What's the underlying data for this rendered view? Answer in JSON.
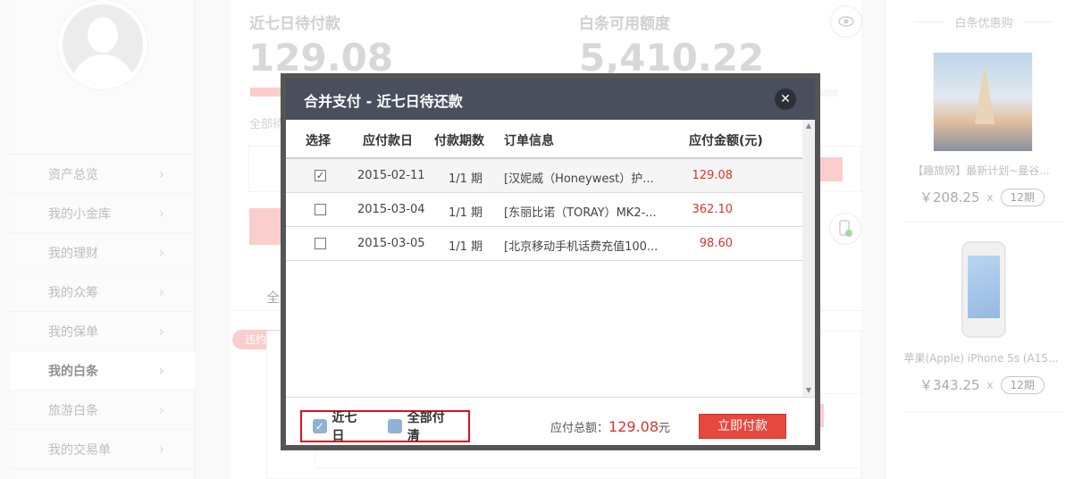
{
  "sidebar": {
    "items": [
      {
        "label": "资产总览"
      },
      {
        "label": "我的小金库"
      },
      {
        "label": "我的理财"
      },
      {
        "label": "我的众筹"
      },
      {
        "label": "我的保单"
      },
      {
        "label": "我的白条"
      },
      {
        "label": "旅游白条"
      },
      {
        "label": "我的交易单"
      }
    ],
    "active_index": 5
  },
  "summary": {
    "due_title": "近七日待付款",
    "due_value": "129.08",
    "credit_title": "白条可用额度",
    "credit_value": "5,410.22",
    "bg_text_all": "全部待",
    "bg_tab": "全",
    "overdue_badge": "违约２天"
  },
  "recommend": {
    "title": "白条优惠购",
    "items": [
      {
        "name": "【趣旅网】最新计划~曼谷...",
        "price": "￥208.25",
        "x": "x",
        "term": "12期"
      },
      {
        "name": "苹果(Apple) iPhone 5s (A15...",
        "price": "￥343.25",
        "x": "x",
        "term": "12期"
      }
    ]
  },
  "modal": {
    "title": "合并支付 - 近七日待还款",
    "close": "✕",
    "columns": [
      "选择",
      "应付款日",
      "付款期数",
      "订单信息",
      "应付金额(元)"
    ],
    "rows": [
      {
        "checked": "✓",
        "date": "2015-02-11",
        "period": "1/1 期",
        "info": "[汉妮威（Honeywest）护...",
        "amount": "129.08"
      },
      {
        "checked": "",
        "date": "2015-03-04",
        "period": "1/1 期",
        "info": "[东丽比诺（TORAY）MK2-...",
        "amount": "362.10"
      },
      {
        "checked": "",
        "date": "2015-03-05",
        "period": "1/1 期",
        "info": "[北京移动手机话费充值100...",
        "amount": "98.60"
      }
    ],
    "options": [
      {
        "label": "近七日",
        "mark": "✓"
      },
      {
        "label": "全部付清",
        "mark": ""
      }
    ],
    "total_label": "应付总额：",
    "total_value": "129.08",
    "total_unit": "元",
    "pay_button": "立即付款"
  },
  "colors": {
    "accent_red": "#e6483d",
    "header_dark": "#4a4f5e",
    "highlight_box": "#d9121f"
  },
  "icons": {
    "eye": "eye-icon",
    "phone": "phone-check-icon",
    "close": "close-icon",
    "chevron": "chevron-right-icon"
  }
}
